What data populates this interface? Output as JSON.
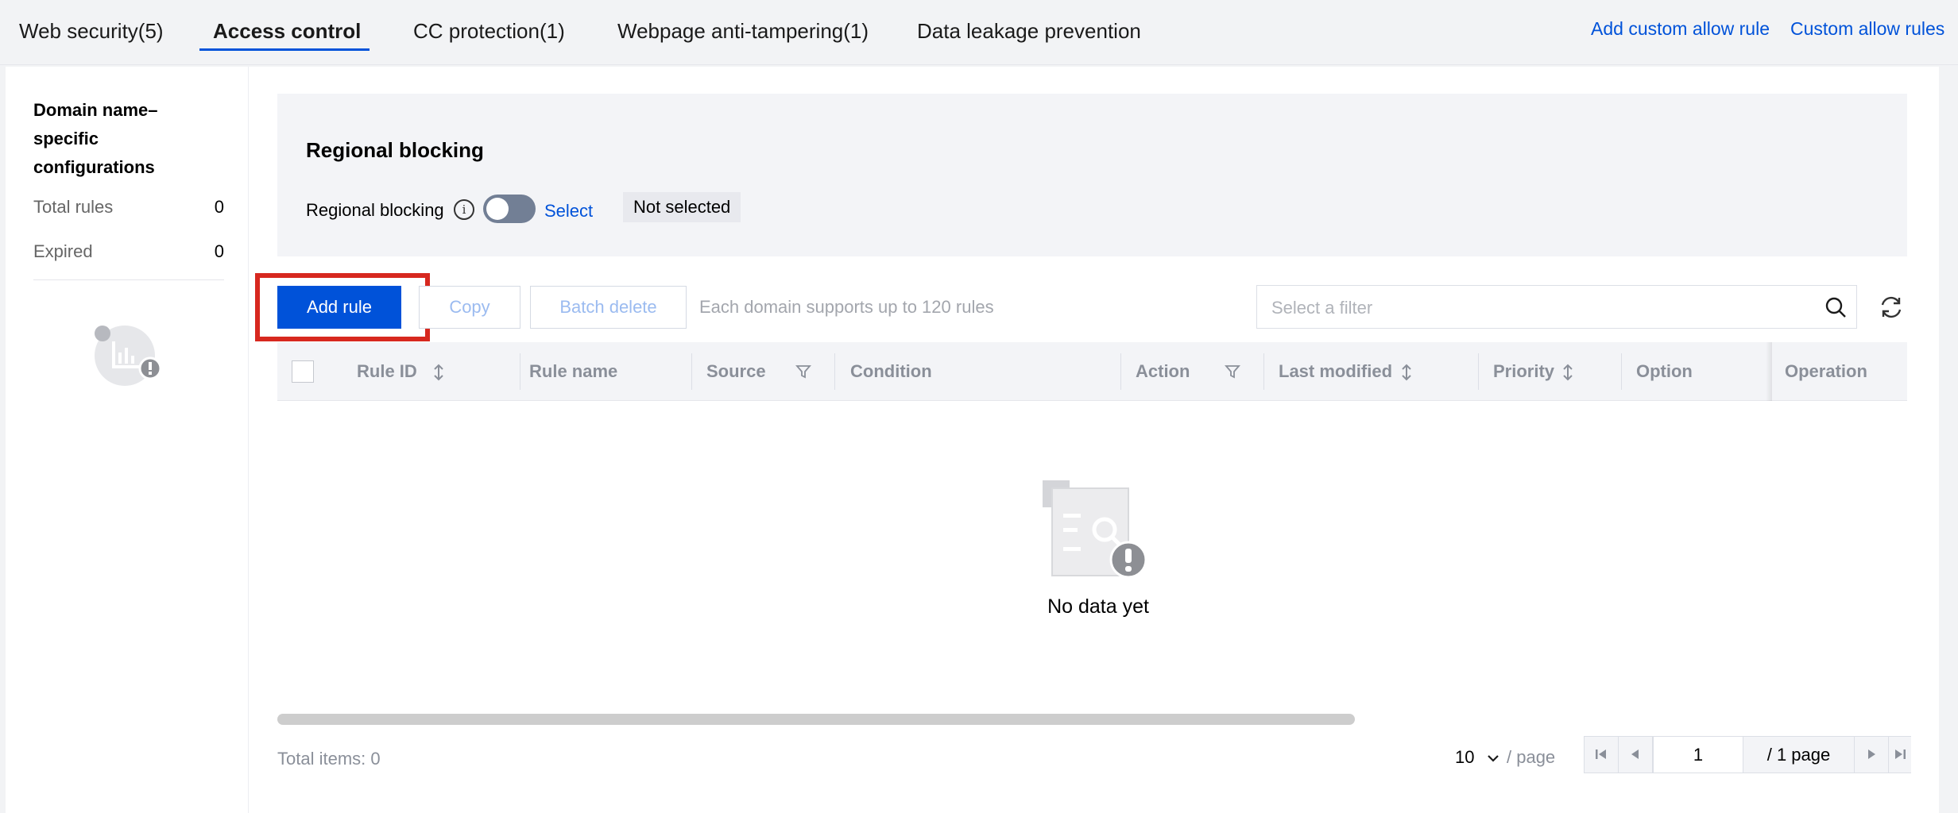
{
  "tabs": [
    {
      "label": "Web security(5)"
    },
    {
      "label": "Access control"
    },
    {
      "label": "CC protection(1)"
    },
    {
      "label": "Webpage anti-tampering(1)"
    },
    {
      "label": "Data leakage prevention"
    }
  ],
  "top_links": {
    "add_custom_allow_rule": "Add custom allow rule",
    "custom_allow_rules": "Custom allow rules"
  },
  "sidebar": {
    "title": "Domain name–specific configurations",
    "total_rules_label": "Total rules",
    "total_rules_value": "0",
    "expired_label": "Expired",
    "expired_value": "0"
  },
  "regional": {
    "title": "Regional blocking",
    "label": "Regional blocking",
    "select_link": "Select",
    "status": "Not selected"
  },
  "toolbar": {
    "add_rule": "Add rule",
    "copy": "Copy",
    "batch_delete": "Batch delete",
    "hint": "Each domain supports up to 120 rules",
    "filter_placeholder": "Select a filter"
  },
  "table": {
    "columns": [
      "Rule ID",
      "Rule name",
      "Source",
      "Condition",
      "Action",
      "Last modified",
      "Priority",
      "Option",
      "Operation"
    ],
    "empty_text": "No data yet"
  },
  "pagination": {
    "total": "Total items: 0",
    "page_size": "10",
    "per_page": "/ page",
    "current_page": "1",
    "total_pages": "/ 1 page"
  },
  "colors": {
    "accent": "#0052d9",
    "highlight": "#d7281f"
  }
}
